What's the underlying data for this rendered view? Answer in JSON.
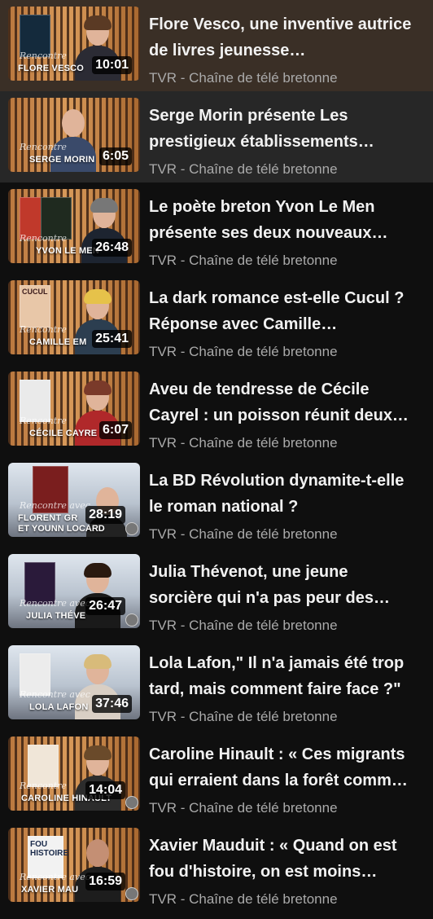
{
  "videos": [
    {
      "title_line1": "Flore Vesco, une inventive autrice",
      "title_line2": "de livres jeunesse…",
      "channel": "TVR - Chaîne de télé bretonne",
      "duration": "10:01",
      "thumb_name": "FLORE VESCO",
      "thumb_name2": "",
      "thumb_script": "Rencontre"
    },
    {
      "title_line1": "Serge Morin présente Les",
      "title_line2": "prestigieux établissements…",
      "channel": "TVR - Chaîne de télé bretonne",
      "duration": "6:05",
      "thumb_name": "SERGE MORIN",
      "thumb_name2": "",
      "thumb_script": "Rencontre"
    },
    {
      "title_line1": "Le poète breton Yvon Le Men",
      "title_line2": "présente ses deux nouveaux…",
      "channel": "TVR - Chaîne de télé bretonne",
      "duration": "26:48",
      "thumb_name": "YVON LE MEN",
      "thumb_name2": "",
      "thumb_script": "Rencontre"
    },
    {
      "title_line1": "La dark romance est-elle Cucul ?",
      "title_line2": "Réponse avec Camille…",
      "channel": "TVR - Chaîne de télé bretonne",
      "duration": "25:41",
      "thumb_name": "CAMILLE EM",
      "thumb_name2": "",
      "thumb_script": "Rencontre"
    },
    {
      "title_line1": "Aveu de tendresse de Cécile",
      "title_line2": "Cayrel : un poisson réunit deux…",
      "channel": "TVR - Chaîne de télé bretonne",
      "duration": "6:07",
      "thumb_name": "CÉCILE CAYRE",
      "thumb_name2": "",
      "thumb_script": "Rencontre"
    },
    {
      "title_line1": "La BD Révolution dynamite-t-elle",
      "title_line2": "le roman national ?",
      "channel": "TVR - Chaîne de télé bretonne",
      "duration": "28:19",
      "thumb_name": "FLORENT GR",
      "thumb_name2": "ET YOUNN LOCARD",
      "thumb_script": "Rencontre avec"
    },
    {
      "title_line1": "Julia Thévenot, une jeune",
      "title_line2": "sorcière qui n'a pas peur des…",
      "channel": "TVR - Chaîne de télé bretonne",
      "duration": "26:47",
      "thumb_name": "JULIA THÉVE",
      "thumb_name2": "",
      "thumb_script": "Rencontre avec"
    },
    {
      "title_line1": "Lola Lafon,\" Il n'a jamais été trop",
      "title_line2": "tard, mais comment faire face ?\"",
      "channel": "TVR - Chaîne de télé bretonne",
      "duration": "37:46",
      "thumb_name": "LOLA LAFON",
      "thumb_name2": "",
      "thumb_script": "Rencontre avec"
    },
    {
      "title_line1": "Caroline Hinault : « Ces migrants",
      "title_line2": "qui erraient dans la forêt comm…",
      "channel": "TVR - Chaîne de télé bretonne",
      "duration": "14:04",
      "thumb_name": "CAROLINE HINAULT",
      "thumb_name2": "",
      "thumb_script": "Rencontre"
    },
    {
      "title_line1": "Xavier Mauduit : « Quand on est",
      "title_line2": "fou d'histoire, on est moins…",
      "channel": "TVR - Chaîne de télé bretonne",
      "duration": "16:59",
      "thumb_name": "XAVIER MAU",
      "thumb_name2": "",
      "thumb_script": "Rencontre avec"
    }
  ],
  "book_labels": {
    "cucul": "CUCUL",
    "fou_histoire": "FOU HISTOIRE"
  }
}
